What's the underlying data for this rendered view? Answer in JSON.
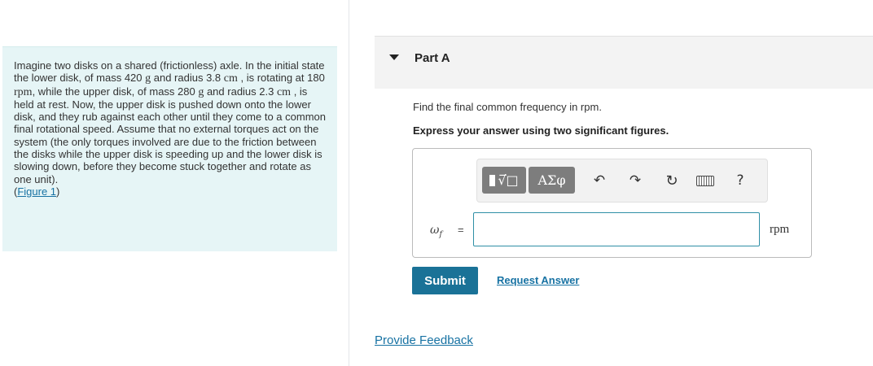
{
  "problem": {
    "segments": [
      "Imagine two disks on a shared (frictionless) axle. In the initial state the lower disk, of mass 420 ",
      "g",
      " and radius 3.8 ",
      "cm",
      " , is rotating at 180 ",
      "rpm",
      ", while the upper disk, of mass 280 ",
      "g",
      " and radius 2.3 ",
      "cm",
      " , is held at rest. Now, the upper disk is pushed down onto the lower disk, and they rub against each other until they come to a common final rotational speed. Assume that no external torques act on the system (the only torques involved are due to the friction between the disks while the upper disk is speeding up and the lower disk is slowing down, before they become stuck together and rotate as one unit).",
      "(",
      "Figure 1",
      ")"
    ]
  },
  "part": {
    "title": "Part A",
    "question": "Find the final common frequency in rpm.",
    "instruction": "Express your answer using two significant figures."
  },
  "toolbar": {
    "templates_glyph": "√̅□",
    "symbols_label": "ΑΣφ",
    "undo_glyph": "↶",
    "redo_glyph": "↷",
    "reset_glyph": "↻",
    "help_glyph": "?"
  },
  "answer": {
    "variable": "ω",
    "subscript": "f",
    "equals": "=",
    "value": "",
    "unit": "rpm"
  },
  "actions": {
    "submit": "Submit",
    "request_answer": "Request Answer",
    "feedback": "Provide Feedback"
  }
}
